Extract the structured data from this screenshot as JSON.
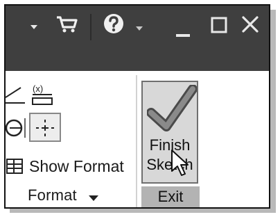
{
  "titlebar": {
    "icons": [
      "dropdown-arrow-icon",
      "shopping-cart-icon",
      "help-icon",
      "minimize-icon",
      "maximize-icon",
      "close-icon"
    ]
  },
  "ribbon": {
    "format_group": {
      "show_format_label": "Show Format",
      "group_label": "Format",
      "icons": [
        "angle-constraint-icon",
        "dimension-icon",
        "construction-icon",
        "centerline-icon",
        "show-format-icon",
        "dropdown-arrow-icon"
      ]
    },
    "exit_group": {
      "finish_sketch_line1": "Finish",
      "finish_sketch_line2": "Sketch",
      "group_label": "Exit",
      "icons": [
        "checkmark-icon"
      ]
    }
  },
  "cursor": {
    "icon": "mouse-pointer-icon"
  }
}
